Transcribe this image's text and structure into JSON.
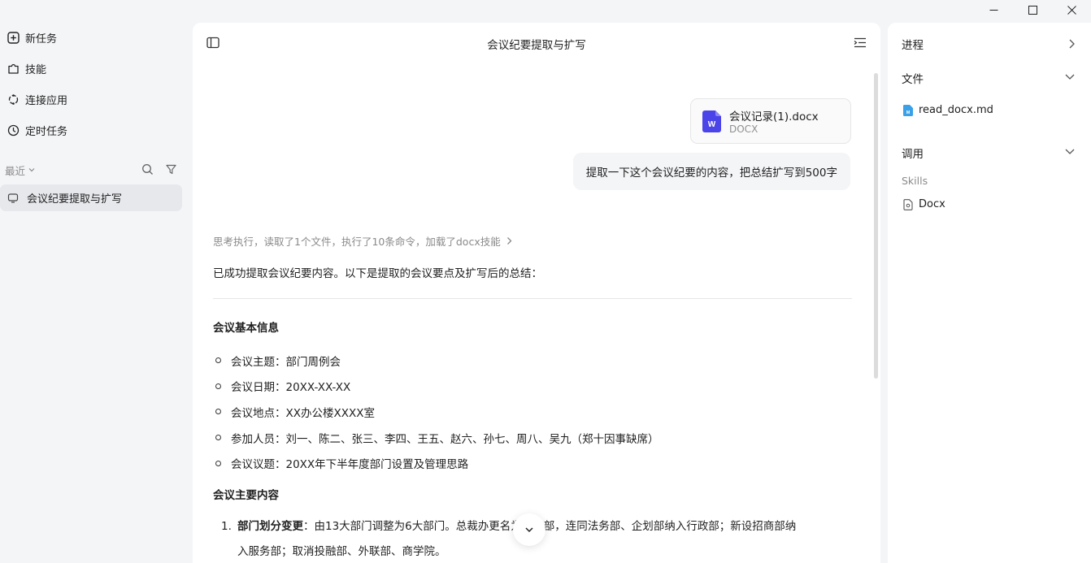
{
  "sidebar": {
    "nav": [
      {
        "label": "新任务",
        "icon": "plus-square-icon"
      },
      {
        "label": "技能",
        "icon": "puzzle-icon"
      },
      {
        "label": "连接应用",
        "icon": "connect-icon"
      },
      {
        "label": "定时任务",
        "icon": "clock-icon"
      }
    ],
    "recent_label": "最近",
    "recent_items": [
      {
        "label": "会议纪要提取与扩写"
      }
    ]
  },
  "main": {
    "title": "会议纪要提取与扩写",
    "attachment": {
      "name": "会议记录(1).docx",
      "type": "DOCX",
      "icon_letter": "W"
    },
    "user_message": "提取一下这个会议纪要的内容，把总结扩写到500字",
    "thinking_summary": "思考执行，读取了1个文件，执行了10条命令，加载了docx技能",
    "intro": "已成功提取会议纪要内容。以下是提取的会议要点及扩写后的总结：",
    "section1_title": "会议基本信息",
    "basic_info": [
      "会议主题：部门周例会",
      "会议日期：20XX-XX-XX",
      "会议地点：XX办公楼XXXX室",
      "参加人员：刘一、陈二、张三、李四、王五、赵六、孙七、周八、吴九（郑十因事缺席）",
      "会议议题：20XX年下半年度部门设置及管理思路"
    ],
    "section2_title": "会议主要内容",
    "main_points": [
      {
        "number": "1.",
        "title": "部门划分变更",
        "sep": "：",
        "line1": "由13大部门调整为6大部门。总裁办更名为文宣部，连同法务部、企划部纳入行政部；新设招商部纳",
        "line2": "入服务部；取消投融部、外联部、商学院。"
      }
    ]
  },
  "right_panel": {
    "progress_label": "进程",
    "files_label": "文件",
    "files": [
      {
        "name": "read_docx.md"
      }
    ],
    "calls_label": "调用",
    "skills_label": "Skills",
    "skills": [
      {
        "name": "Docx"
      }
    ]
  },
  "colors": {
    "app_bg": "#f4f5f7",
    "panel_bg": "#ffffff",
    "word_blue": "#4b44e8",
    "md_icon_blue": "#3aa0e8",
    "muted_text": "#8a8a8a"
  }
}
